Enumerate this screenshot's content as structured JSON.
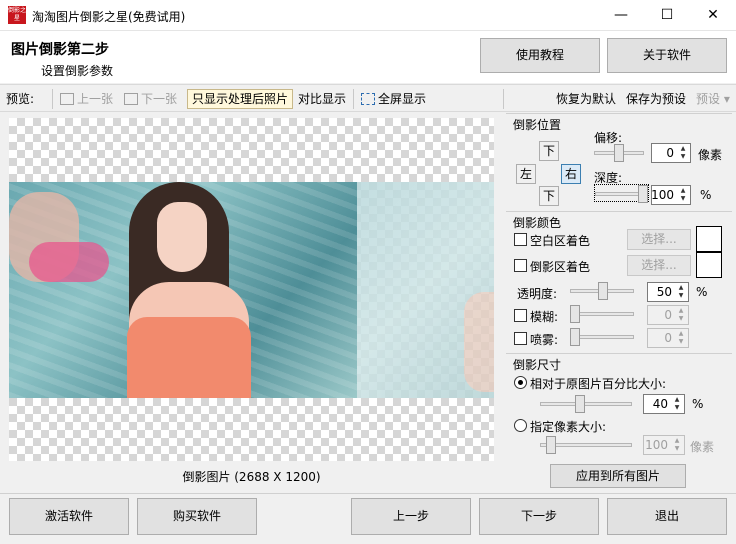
{
  "window": {
    "title": "淘淘图片倒影之星(免费试用)",
    "icon_text": "倒影之星",
    "controls": {
      "minimize": "—",
      "maximize": "☐",
      "close": "✕"
    }
  },
  "header": {
    "title": "图片倒影第二步",
    "subtitle": "设置倒影参数",
    "tutorial_button": "使用教程",
    "about_button": "关于软件"
  },
  "toolbar": {
    "preview_label": "预览:",
    "prev": "上一张",
    "next": "下一张",
    "only_processed": "只显示处理后照片",
    "compare": "对比显示",
    "fullscreen": "全屏显示",
    "restore_default": "恢复为默认",
    "save_preset": "保存为预设",
    "preset": "预设 ▾"
  },
  "preview": {
    "caption": "倒影图片 (2688 X 1200)"
  },
  "settings": {
    "position": {
      "title": "倒影位置",
      "up": "下",
      "left": "左",
      "right": "右",
      "down": "下",
      "selected": "右",
      "offset_label": "偏移:",
      "offset_value": "0",
      "offset_unit": "像素",
      "depth_label": "深度:",
      "depth_value": "100",
      "depth_unit": "%"
    },
    "color": {
      "title": "倒影颜色",
      "blank_area_label": "空白区着色",
      "shadow_area_label": "倒影区着色",
      "choose": "选择...",
      "blank_area_checked": false,
      "shadow_area_checked": false,
      "opacity_label": "透明度:",
      "opacity_value": "50",
      "opacity_unit": "%",
      "blur_label": "模糊:",
      "blur_value": "0",
      "blur_checked": false,
      "spray_label": "喷雾:",
      "spray_value": "0",
      "spray_checked": false
    },
    "size": {
      "title": "倒影尺寸",
      "relative_label": "相对于原图片百分比大小:",
      "relative_value": "40",
      "relative_unit": "%",
      "relative_selected": true,
      "pixel_label": "指定像素大小:",
      "pixel_value": "100",
      "pixel_unit": "像素",
      "pixel_selected": false
    },
    "apply_all": "应用到所有图片"
  },
  "footer": {
    "activate": "激活软件",
    "buy": "购买软件",
    "prev_step": "上一步",
    "next_step": "下一步",
    "exit": "退出"
  }
}
